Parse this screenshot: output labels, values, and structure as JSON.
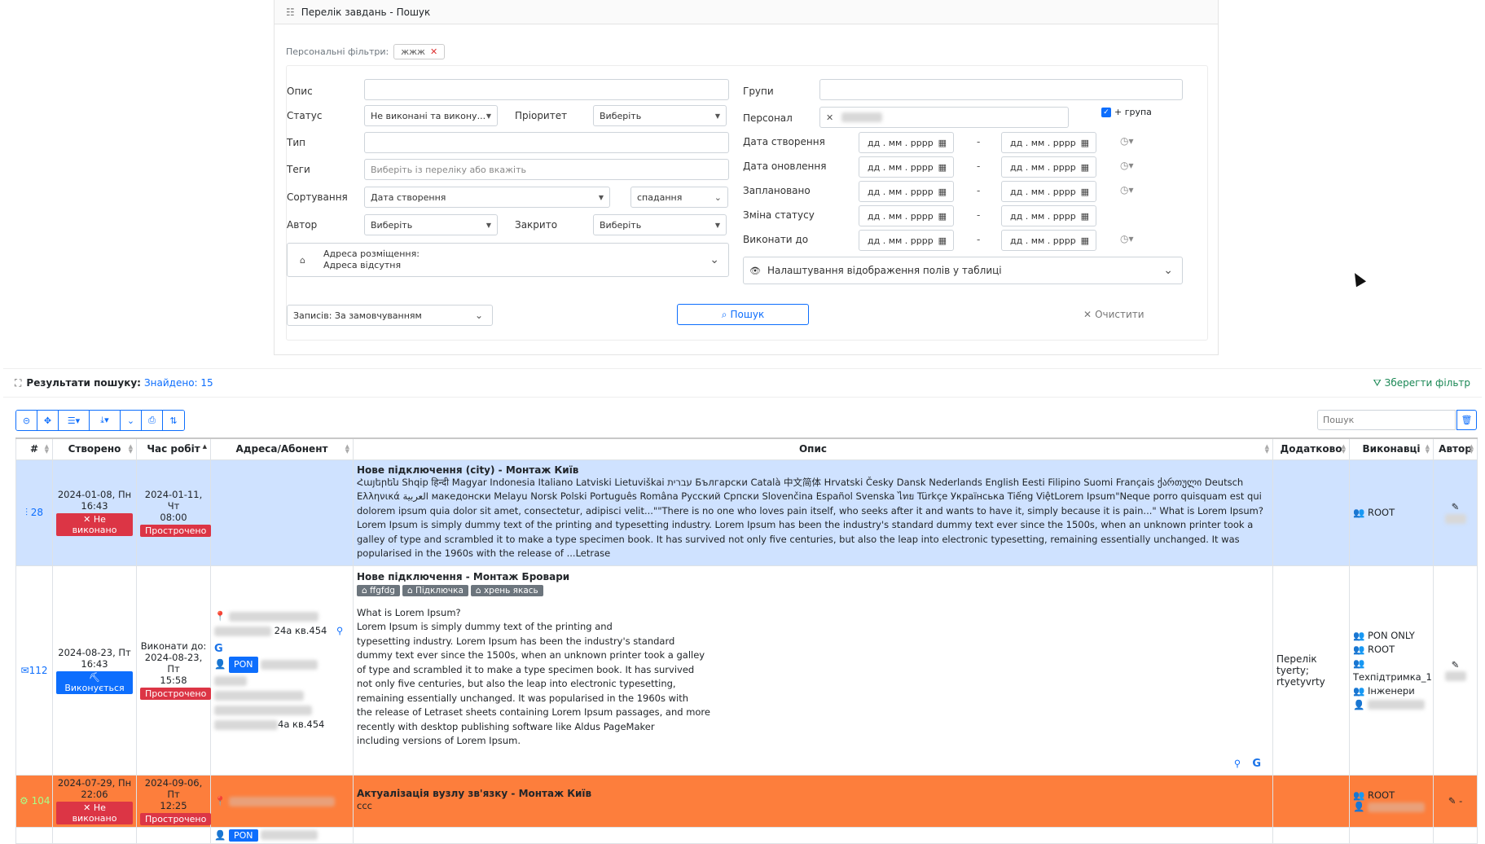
{
  "header": {
    "title": "Перелік завдань - Пошук"
  },
  "personal_filters": {
    "label": "Персональні фільтри:",
    "chip": "жжж"
  },
  "filters": {
    "opys": "Опис",
    "status": "Статус",
    "status_value": "Не виконані та викону...",
    "priority": "Пріоритет",
    "priority_value": "Виберіть",
    "type": "Тип",
    "tags": "Теги",
    "tags_placeholder": "Виберіть із переліку або вкажіть",
    "sort": "Сортування",
    "sort_value": "Дата створення",
    "sort_dir": "спадання",
    "author": "Автор",
    "author_value": "Виберіть",
    "closed": "Закрито",
    "closed_value": "Виберіть",
    "address_label": "Адреса розміщення:",
    "address_value": "Адреса відсутня",
    "groups": "Групи",
    "personnel": "Персонал",
    "plus_group": "+ група",
    "date_created": "Дата створення",
    "date_updated": "Дата оновлення",
    "date_planned": "Заплановано",
    "date_status": "Зміна статусу",
    "date_due": "Виконати до",
    "date_placeholder": "дд . мм . рррр",
    "display_settings": "Налаштування відображення полів у таблиці",
    "records": "Записів: За замовчуванням",
    "search_btn": "Пошук",
    "clear_btn": "Очистити"
  },
  "results": {
    "label": "Результати пошуку:",
    "found": "Знайдено: 15",
    "save_filter": "Зберегти фільтр",
    "search_placeholder": "Пошук"
  },
  "columns": [
    "#",
    "Створено",
    "Час робіт",
    "Адреса/Абонент",
    "Опис",
    "Додатково",
    "Виконавці",
    "Автор"
  ],
  "rows": [
    {
      "num": "28",
      "created_date": "2024-01-08, Пн",
      "created_time": "16:43",
      "status": "✕ Не виконано",
      "work_date": "2024-01-11, Чт",
      "work_time": "08:00",
      "overdue": "Прострочено",
      "title": "Нове підключення (city) - Монтаж Київ",
      "desc": "Հայերեն Shqip हिन्दी Magyar Indonesia Italiano Latviski Lietuviškai עברית Български Català 中文简体 Hrvatski Česky Dansk Nederlands English Eesti Filipino Suomi Français ქართული Deutsch Ελληνικά العربية македонски Melayu Norsk Polski Português Româna Русский Српски Slovenčina Español Svenska ไทย Türkçe Українська Tiếng ViệtLorem Ipsum\"Neque porro quisquam est qui dolorem ipsum quia dolor sit amet, consectetur, adipisci velit...\"\"There is no one who loves pain itself, who seeks after it and wants to have it, simply because it is pain...\"  What is Lorem Ipsum?Lorem Ipsum is simply dummy text of the printing and typesetting industry. Lorem Ipsum has been the industry's standard dummy text ever since the 1500s, when an unknown printer took a galley of type and scrambled it to make a type specimen book. It has survived not only five centuries, but also the leap into electronic typesetting, remaining essentially unchanged. It was popularised in the 1960s with the release of ...Letrase",
      "executor": "ROOT"
    },
    {
      "num": "112",
      "created_date": "2024-08-23, Пт",
      "created_time": "16:43",
      "status": "⛏ Виконується",
      "due_label": "Виконати до:",
      "work_date": "2024-08-23, Пт",
      "work_time": "15:58",
      "overdue": "Прострочено",
      "addr1": "24а кв.454",
      "pon": "PON",
      "addr2": "4а кв.454",
      "title": "Нове підключення - Монтаж Бровари",
      "tags": [
        "ffgfdg",
        "Підключка",
        "хрень якась"
      ],
      "desc": "What is Lorem Ipsum?\nLorem Ipsum is simply dummy text of the printing and\ntypesetting industry. Lorem Ipsum has been the industry's standard\ndummy text ever since the 1500s, when an unknown printer took a galley\nof type and scrambled it to make a type specimen book. It has survived\nnot only five centuries, but also the leap into electronic typesetting,\nremaining essentially unchanged. It was popularised in the 1960s with\nthe release of Letraset sheets containing Lorem Ipsum passages, and more\nrecently with desktop publishing software like Aldus PageMaker\nincluding versions of Lorem Ipsum.",
      "extra": "Перелік tyerty; rtyetyvrty",
      "executors": [
        "PON ONLY",
        "ROOT",
        "Техпідтримка_1",
        "Інженери"
      ]
    },
    {
      "num": "104",
      "created_date": "2024-07-29, Пн",
      "created_time": "22:06",
      "status": "✕ Не виконано",
      "work_date": "2024-09-06, Пт",
      "work_time": "12:25",
      "overdue": "Прострочено",
      "title": "Актуалізація вузлу зв'язку - Монтаж Київ",
      "desc": "ccc",
      "executor": "ROOT",
      "author": "-"
    },
    {
      "pon": "PON"
    }
  ],
  "icons": [
    "list-icon",
    "home-icon",
    "calendar-icon",
    "clock-icon",
    "eye-slash-icon",
    "search-icon",
    "x-icon",
    "binoculars-icon",
    "filter-icon",
    "trash-icon",
    "users-icon",
    "user-icon",
    "map-pin-icon",
    "google-icon",
    "edit-icon",
    "chevron-down-icon"
  ],
  "colors": {
    "accent": "#0d6efd",
    "danger": "#dc3545",
    "row_blue": "#cfe2ff",
    "row_orange": "#fd7e3c",
    "success": "#198754"
  }
}
